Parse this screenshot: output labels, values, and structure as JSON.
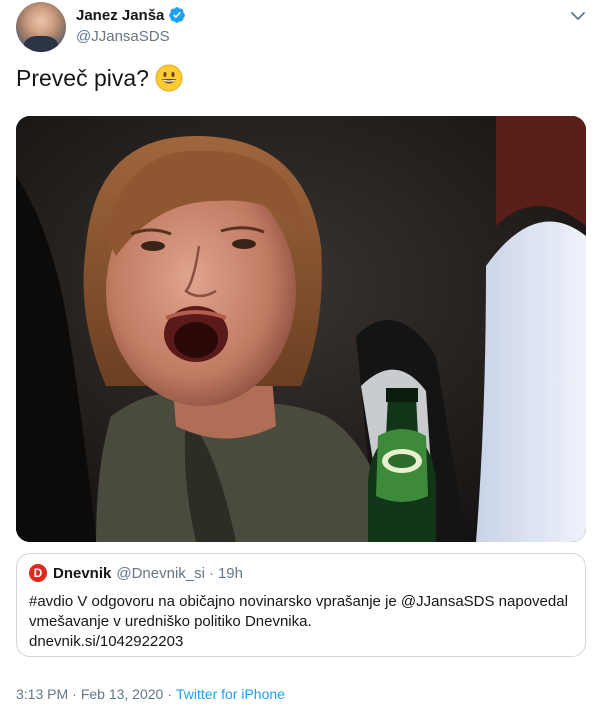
{
  "author": {
    "name": "Janez Janša",
    "handle": "@JJansaSDS"
  },
  "tweet": {
    "text": "Preveč piva?"
  },
  "quoted": {
    "name": "Dnevnik",
    "logo_letter": "D",
    "handle": "@Dnevnik_si",
    "dot": "·",
    "time": "19h",
    "text": "#avdio V odgovoru na običajno novinarsko vprašanje je @JJansaSDS napovedal vmešavanje v uredniško politiko Dnevnika.",
    "link": "dnevnik.si/1042922203"
  },
  "footer": {
    "time": "3:13 PM",
    "dot1": "·",
    "date": "Feb 13, 2020",
    "dot2": "·",
    "source": "Twitter for iPhone"
  },
  "colors": {
    "accent": "#1da1f2",
    "muted": "#657786",
    "dnevnik_red": "#e0281e"
  },
  "icons": [
    "verified-badge-icon",
    "chevron-down-icon",
    "grinning-face-emoji"
  ]
}
